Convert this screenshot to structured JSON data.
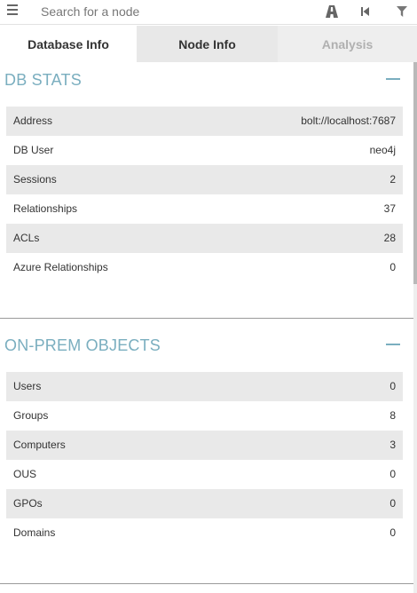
{
  "search": {
    "placeholder": "Search for a node"
  },
  "toolbar": {
    "menu_icon": "hamburger-menu-icon",
    "path_icon": "road-path-icon",
    "back_icon": "step-backward-icon",
    "filter_icon": "filter-icon"
  },
  "tabs": [
    {
      "label": "Database Info",
      "active": true
    },
    {
      "label": "Node Info",
      "active": false
    },
    {
      "label": "Analysis",
      "active": false,
      "disabled": true
    }
  ],
  "db_stats": {
    "title": "DB STATS",
    "rows": [
      {
        "label": "Address",
        "value": "bolt://localhost:7687"
      },
      {
        "label": "DB User",
        "value": "neo4j"
      },
      {
        "label": "Sessions",
        "value": "2"
      },
      {
        "label": "Relationships",
        "value": "37"
      },
      {
        "label": "ACLs",
        "value": "28"
      },
      {
        "label": "Azure Relationships",
        "value": "0"
      }
    ]
  },
  "on_prem": {
    "title": "ON-PREM OBJECTS",
    "rows": [
      {
        "label": "Users",
        "value": "0"
      },
      {
        "label": "Groups",
        "value": "8"
      },
      {
        "label": "Computers",
        "value": "3"
      },
      {
        "label": "OUS",
        "value": "0"
      },
      {
        "label": "GPOs",
        "value": "0"
      },
      {
        "label": "Domains",
        "value": "0"
      }
    ]
  },
  "colors": {
    "accent": "#7aaebf",
    "row_shade": "#e9e9e9"
  }
}
